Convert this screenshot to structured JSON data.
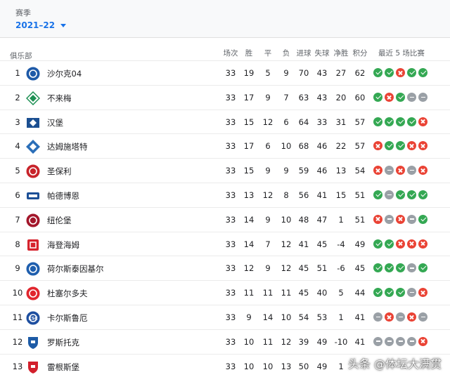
{
  "season": {
    "label": "赛季",
    "value": "2021–22"
  },
  "columns": {
    "club": "俱乐部",
    "played": "场次",
    "won": "胜",
    "drawn": "平",
    "lost": "负",
    "gf": "进球",
    "ga": "失球",
    "gd": "净胜",
    "pts": "积分",
    "form": "最近 5 场比赛"
  },
  "colors": {
    "win": "#34a853",
    "loss": "#ea4335",
    "draw": "#9aa0a6",
    "accent": "#1a73e8"
  },
  "teams": [
    {
      "rank": "1",
      "name": "沙尔克04",
      "p": "33",
      "w": "19",
      "d": "5",
      "l": "9",
      "gf": "70",
      "ga": "43",
      "gd": "27",
      "pts": "62",
      "form": [
        "W",
        "W",
        "L",
        "W",
        "W"
      ],
      "logo": {
        "bg": "#1e5aa8",
        "fg": "#ffffff",
        "shape": "circle"
      }
    },
    {
      "rank": "2",
      "name": "不来梅",
      "p": "33",
      "w": "17",
      "d": "9",
      "l": "7",
      "gf": "63",
      "ga": "43",
      "gd": "20",
      "pts": "60",
      "form": [
        "W",
        "L",
        "W",
        "D",
        "D"
      ],
      "logo": {
        "bg": "#ffffff",
        "fg": "#1d9053",
        "shape": "diamond"
      }
    },
    {
      "rank": "3",
      "name": "汉堡",
      "p": "33",
      "w": "15",
      "d": "12",
      "l": "6",
      "gf": "64",
      "ga": "33",
      "gd": "31",
      "pts": "57",
      "form": [
        "W",
        "W",
        "W",
        "W",
        "L"
      ],
      "logo": {
        "bg": "#1b4f91",
        "fg": "#ffffff",
        "shape": "diamond-rect"
      }
    },
    {
      "rank": "4",
      "name": "达姆施塔特",
      "p": "33",
      "w": "17",
      "d": "6",
      "l": "10",
      "gf": "68",
      "ga": "46",
      "gd": "22",
      "pts": "57",
      "form": [
        "L",
        "W",
        "W",
        "L",
        "L"
      ],
      "logo": {
        "bg": "#2a6eb8",
        "fg": "#ffffff",
        "shape": "diamond"
      }
    },
    {
      "rank": "5",
      "name": "圣保利",
      "p": "33",
      "w": "15",
      "d": "9",
      "l": "9",
      "gf": "59",
      "ga": "46",
      "gd": "13",
      "pts": "54",
      "form": [
        "L",
        "D",
        "L",
        "D",
        "L"
      ],
      "logo": {
        "bg": "#c8242b",
        "fg": "#ffffff",
        "shape": "circle"
      }
    },
    {
      "rank": "6",
      "name": "帕德博恩",
      "p": "33",
      "w": "13",
      "d": "12",
      "l": "8",
      "gf": "56",
      "ga": "41",
      "gd": "15",
      "pts": "51",
      "form": [
        "W",
        "D",
        "W",
        "W",
        "W"
      ],
      "logo": {
        "bg": "#1c4f96",
        "fg": "#ffffff",
        "shape": "wide"
      }
    },
    {
      "rank": "7",
      "name": "纽伦堡",
      "p": "33",
      "w": "14",
      "d": "9",
      "l": "10",
      "gf": "48",
      "ga": "47",
      "gd": "1",
      "pts": "51",
      "form": [
        "L",
        "D",
        "L",
        "D",
        "W"
      ],
      "logo": {
        "bg": "#a3172b",
        "fg": "#ffffff",
        "shape": "circle"
      }
    },
    {
      "rank": "8",
      "name": "海登海姆",
      "p": "33",
      "w": "14",
      "d": "7",
      "l": "12",
      "gf": "41",
      "ga": "45",
      "gd": "-4",
      "pts": "49",
      "form": [
        "W",
        "W",
        "L",
        "L",
        "L"
      ],
      "logo": {
        "bg": "#d6232d",
        "fg": "#ffffff",
        "shape": "square"
      }
    },
    {
      "rank": "9",
      "name": "荷尔斯泰因基尔",
      "p": "33",
      "w": "12",
      "d": "9",
      "l": "12",
      "gf": "45",
      "ga": "51",
      "gd": "-6",
      "pts": "45",
      "form": [
        "W",
        "W",
        "W",
        "D",
        "W"
      ],
      "logo": {
        "bg": "#1f5fae",
        "fg": "#ffffff",
        "shape": "circle"
      }
    },
    {
      "rank": "10",
      "name": "杜塞尔多夫",
      "p": "33",
      "w": "11",
      "d": "11",
      "l": "11",
      "gf": "45",
      "ga": "40",
      "gd": "5",
      "pts": "44",
      "form": [
        "W",
        "W",
        "W",
        "D",
        "L"
      ],
      "logo": {
        "bg": "#e1262e",
        "fg": "#ffffff",
        "shape": "circle"
      }
    },
    {
      "rank": "11",
      "name": "卡尔斯鲁厄",
      "p": "33",
      "w": "9",
      "d": "14",
      "l": "10",
      "gf": "54",
      "ga": "53",
      "gd": "1",
      "pts": "41",
      "form": [
        "D",
        "L",
        "D",
        "L",
        "D"
      ],
      "logo": {
        "bg": "#1e4fa0",
        "fg": "#ffffff",
        "shape": "circle",
        "text": "KSC"
      }
    },
    {
      "rank": "12",
      "name": "罗斯托克",
      "p": "33",
      "w": "10",
      "d": "11",
      "l": "12",
      "gf": "39",
      "ga": "49",
      "gd": "-10",
      "pts": "41",
      "form": [
        "D",
        "D",
        "D",
        "D",
        "L"
      ],
      "logo": {
        "bg": "#1d5ba6",
        "fg": "#ffffff",
        "shape": "shield"
      }
    },
    {
      "rank": "13",
      "name": "雷根斯堡",
      "p": "33",
      "w": "10",
      "d": "10",
      "l": "13",
      "gf": "50",
      "ga": "49",
      "gd": "1",
      "pts": "",
      "form": [],
      "logo": {
        "bg": "#d21f2b",
        "fg": "#ffffff",
        "shape": "shield"
      }
    }
  ],
  "watermark": "头条 @体坛大满贯"
}
